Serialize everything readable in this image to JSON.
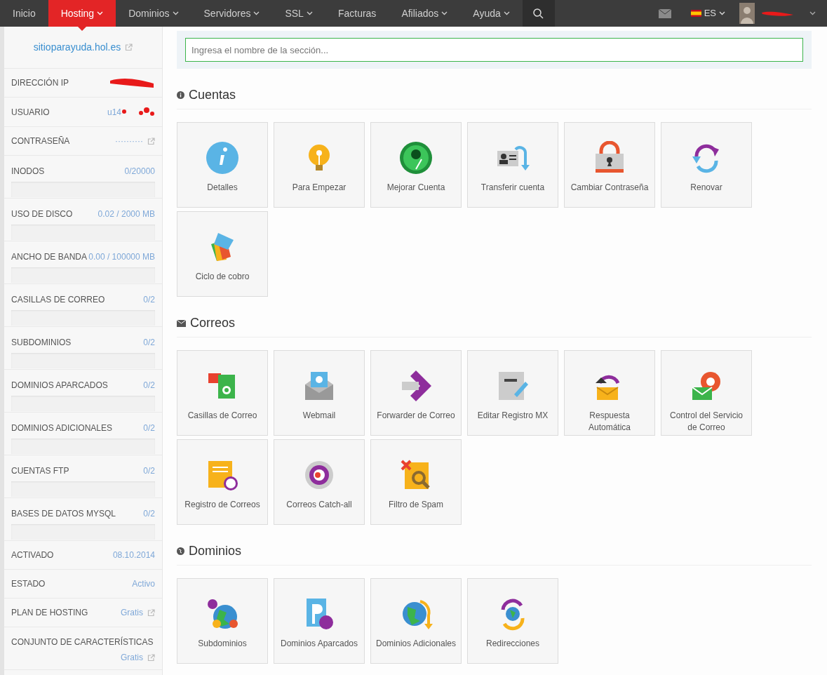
{
  "nav": {
    "items": [
      {
        "label": "Inicio",
        "selected": false,
        "dropdown": false
      },
      {
        "label": "Hosting",
        "selected": true,
        "dropdown": true
      },
      {
        "label": "Dominios",
        "selected": false,
        "dropdown": true
      },
      {
        "label": "Servidores",
        "selected": false,
        "dropdown": true
      },
      {
        "label": "SSL",
        "selected": false,
        "dropdown": true
      },
      {
        "label": "Facturas",
        "selected": false,
        "dropdown": false
      },
      {
        "label": "Afiliados",
        "selected": false,
        "dropdown": true
      },
      {
        "label": "Ayuda",
        "selected": false,
        "dropdown": true
      }
    ],
    "language": "ES"
  },
  "sidebar": {
    "site": "sitioparayuda.hol.es",
    "rows": [
      {
        "kind": "redacted",
        "label": "DIRECCIÓN IP"
      },
      {
        "kind": "partial",
        "label": "USUARIO",
        "value": "u14"
      },
      {
        "kind": "link",
        "label": "CONTRASEÑA",
        "value": "··········"
      },
      {
        "kind": "meter",
        "label": "INODOS",
        "value": "0/20000",
        "level": 0
      },
      {
        "kind": "meter",
        "label": "USO DE DISCO",
        "value": "0.02 / 2000 MB",
        "level": 0
      },
      {
        "kind": "meter",
        "label": "ANCHO DE BANDA",
        "value": "0.00 / 100000 MB",
        "level": 0
      },
      {
        "kind": "meter",
        "label": "CASILLAS DE CORREO",
        "value": "0/2",
        "level": 0
      },
      {
        "kind": "meter",
        "label": "SUBDOMINIOS",
        "value": "0/2",
        "level": 0
      },
      {
        "kind": "meter",
        "label": "DOMINIOS APARCADOS",
        "value": "0/2",
        "level": 0
      },
      {
        "kind": "meter",
        "label": "DOMINIOS ADICIONALES",
        "value": "0/2",
        "level": 0
      },
      {
        "kind": "meter",
        "label": "CUENTAS FTP",
        "value": "0/2",
        "level": 0
      },
      {
        "kind": "meter",
        "label": "BASES DE DATOS MYSQL",
        "value": "0/2",
        "level": 0
      },
      {
        "kind": "value",
        "label": "ACTIVADO",
        "value": "08.10.2014"
      },
      {
        "kind": "value",
        "label": "ESTADO",
        "value": "Activo"
      },
      {
        "kind": "link",
        "label": "PLAN DE HOSTING",
        "value": "Gratis"
      },
      {
        "kind": "stacked-link",
        "label": "CONJUNTO DE CARACTERÍSTICAS",
        "value": "Gratis"
      }
    ]
  },
  "search": {
    "placeholder": "Ingresa el nombre de la sección..."
  },
  "sections": [
    {
      "title": "Cuentas",
      "kind": "info",
      "tiles": [
        "Detalles",
        "Para Empezar",
        "Mejorar Cuenta",
        "Transferir cuenta",
        "Cambiar Contraseña",
        "Renovar",
        "Ciclo de cobro"
      ]
    },
    {
      "title": "Correos",
      "kind": "mail",
      "tiles": [
        "Casillas de Correo",
        "Webmail",
        "Forwarder de Correo",
        "Editar Registro MX",
        "Respuesta Automática",
        "Control del Servicio de Correo",
        "Registro de Correos",
        "Correos Catch-all",
        "Filtro de Spam"
      ]
    },
    {
      "title": "Dominios",
      "kind": "globe",
      "tiles": [
        "Subdominios",
        "Dominios Aparcados",
        "Dominios Adicionales",
        "Redirecciones"
      ]
    }
  ]
}
